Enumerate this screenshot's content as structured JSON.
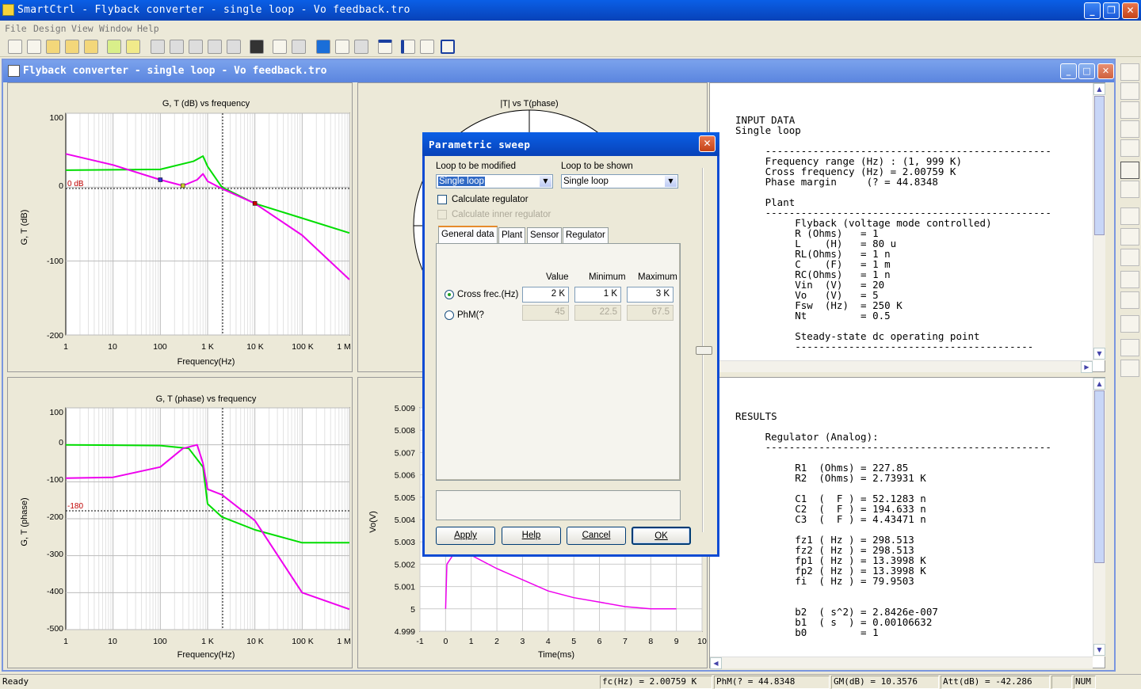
{
  "app": {
    "title": "SmartCtrl - Flyback converter - single loop - Vo feedback.tro"
  },
  "menu": [
    "File",
    "Design",
    "View",
    "Window",
    "Help"
  ],
  "doc": {
    "title": "Flyback converter - single loop - Vo feedback.tro"
  },
  "charts": {
    "gain": {
      "title": "G, T (dB) vs frequency",
      "ylabel": "G, T (dB)",
      "xlabel": "Frequency(Hz)",
      "yticks": [
        "100",
        "0",
        "-100",
        "-200"
      ],
      "xticks": [
        "1",
        "10",
        "100",
        "1 K",
        "10 K",
        "100 K",
        "1 M"
      ],
      "ref_label": "0 dB"
    },
    "nyquist": {
      "title": "|T| vs T(phase)"
    },
    "phase": {
      "title": "G, T (phase) vs frequency",
      "ylabel": "G, T (phase)",
      "xlabel": "Frequency(Hz)",
      "yticks": [
        "100",
        "0",
        "-100",
        "-200",
        "-300",
        "-400",
        "-500"
      ],
      "xticks": [
        "1",
        "10",
        "100",
        "1 K",
        "10 K",
        "100 K",
        "1 M"
      ],
      "ref_label": "-180"
    },
    "transient": {
      "ylabel": "Vo(V)",
      "xlabel": "Time(ms)",
      "yticks": [
        "5.009",
        "5.008",
        "5.007",
        "5.006",
        "5.005",
        "5.004",
        "5.003",
        "5.002",
        "5.001",
        "5",
        "4.999"
      ],
      "xticks": [
        "-1",
        "0",
        "1",
        "2",
        "3",
        "4",
        "5",
        "6",
        "7",
        "8",
        "9",
        "10"
      ]
    }
  },
  "chart_data": [
    {
      "type": "line",
      "title": "G, T (dB) vs frequency",
      "xlabel": "Frequency(Hz)",
      "ylabel": "G, T (dB)",
      "xscale": "log",
      "xlim": [
        1,
        1000000
      ],
      "ylim": [
        -200,
        100
      ],
      "series": [
        {
          "color": "#00dd00",
          "x": [
            1,
            100,
            500,
            800,
            1000,
            2000,
            10000,
            100000,
            1000000
          ],
          "y": [
            23,
            24,
            35,
            42,
            28,
            0,
            -22,
            -42,
            -62
          ]
        },
        {
          "color": "#ee00ee",
          "x": [
            1,
            10,
            100,
            300,
            600,
            800,
            1000,
            2000,
            10000,
            100000,
            1000000
          ],
          "y": [
            45,
            30,
            10,
            2,
            10,
            18,
            8,
            -2,
            -22,
            -65,
            -125
          ]
        }
      ]
    },
    {
      "type": "line",
      "title": "G, T (phase) vs frequency",
      "xlabel": "Frequency(Hz)",
      "ylabel": "G, T (phase)",
      "xscale": "log",
      "xlim": [
        1,
        1000000
      ],
      "ylim": [
        -500,
        100
      ],
      "series": [
        {
          "color": "#00dd00",
          "x": [
            1,
            100,
            400,
            800,
            1000,
            2000,
            10000,
            100000,
            1000000
          ],
          "y": [
            0,
            -2,
            -10,
            -60,
            -160,
            -195,
            -230,
            -265,
            -265
          ]
        },
        {
          "color": "#ee00ee",
          "x": [
            1,
            10,
            100,
            300,
            600,
            800,
            1000,
            2000,
            10000,
            100000,
            1000000
          ],
          "y": [
            -90,
            -88,
            -60,
            -10,
            0,
            -50,
            -120,
            -135,
            -205,
            -400,
            -445
          ]
        }
      ]
    },
    {
      "type": "line",
      "xlabel": "Time(ms)",
      "ylabel": "Vo(V)",
      "xlim": [
        -1,
        10
      ],
      "ylim": [
        4.999,
        5.009
      ],
      "series": [
        {
          "color": "#ee00ee",
          "x": [
            0,
            0.05,
            0.4,
            1,
            2,
            3,
            4,
            5,
            6,
            7,
            8,
            9
          ],
          "y": [
            5.0,
            5.002,
            5.0026,
            5.0024,
            5.0018,
            5.0013,
            5.0008,
            5.0005,
            5.0003,
            5.0001,
            5.0,
            5.0
          ]
        }
      ]
    }
  ],
  "input_text": "INPUT DATA\nSingle loop\n\n     ------------------------------------------------\n     Frequency range (Hz) : (1, 999 K)\n     Cross frequency (Hz) = 2.00759 K\n     Phase margin     (? = 44.8348\n\n     Plant\n     ------------------------------------------------\n          Flyback (voltage mode controlled)\n          R (Ohms)   = 1\n          L    (H)   = 80 u\n          RL(Ohms)   = 1 n\n          C    (F)   = 1 m\n          RC(Ohms)   = 1 n\n          Vin  (V)   = 20\n          Vo   (V)   = 5\n          Fsw  (Hz)  = 250 K\n          Nt         = 0.5\n\n          Steady-state dc operating point\n          ----------------------------------------",
  "results_text": "RESULTS\n\n     Regulator (Analog):\n     ------------------------------------------------\n\n          R1  (Ohms) = 227.85\n          R2  (Ohms) = 2.73931 K\n\n          C1  (  F ) = 52.1283 n\n          C2  (  F ) = 194.633 n\n          C3  (  F ) = 4.43471 n\n\n          fz1 ( Hz ) = 298.513\n          fz2 ( Hz ) = 298.513\n          fp1 ( Hz ) = 13.3998 K\n          fp2 ( Hz ) = 13.3998 K\n          fi  ( Hz ) = 79.9503\n\n\n          b2  ( s^2) = 2.8426e-007\n          b1  ( s  ) = 0.00106632\n          b0         = 1",
  "dialog": {
    "title": "Parametric sweep",
    "loop_modified_label": "Loop to be modified",
    "loop_modified_value": "Single loop",
    "loop_shown_label": "Loop to be shown",
    "loop_shown_value": "Single loop",
    "calc_regulator": "Calculate regulator",
    "calc_inner": "Calculate inner regulator",
    "tabs": [
      "General data",
      "Plant",
      "Sensor",
      "Regulator"
    ],
    "col_value": "Value",
    "col_min": "Minimum",
    "col_max": "Maximum",
    "row1_label": "Cross frec.(Hz)",
    "row1_value": "2 K",
    "row1_min": "1 K",
    "row1_max": "3 K",
    "row2_label": "PhM(?",
    "row2_value": "45",
    "row2_min": "22.5",
    "row2_max": "67.5",
    "apply": "Apply",
    "help": "Help",
    "cancel": "Cancel",
    "ok": "OK"
  },
  "status": {
    "ready": "Ready",
    "fc": "fc(Hz) = 2.00759 K",
    "phm": "PhM(? = 44.8348",
    "gm": "GM(dB) = 10.3576",
    "att": "Att(dB) = -42.286",
    "num": "NUM"
  }
}
